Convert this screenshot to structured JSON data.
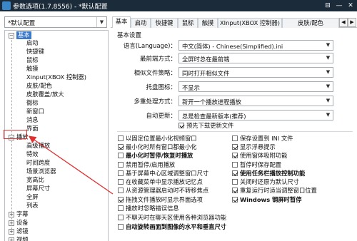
{
  "window": {
    "title": "参数选项(1.7.8556) - *默认配置",
    "buttons": {
      "close_prev": "⊟",
      "minimize": "—",
      "close": "✕"
    }
  },
  "profile": {
    "selected": "*默认配置"
  },
  "tree": {
    "groups": [
      {
        "label": "基本",
        "expanded": true,
        "selected": true,
        "children": [
          "启动",
          "快捷键",
          "鼠标",
          "触摸",
          "Xinput(XBOX 控制器)",
          "皮肤/配色",
          "皮肤覆盖/放大",
          "徽标",
          "新窗口",
          "消息",
          "界面"
        ]
      },
      {
        "label": "播放",
        "expanded": true,
        "highlighted": true,
        "children": [
          "高级播放",
          "特效",
          "时间跨度",
          "场景浏览器",
          "宽高比",
          "屏幕尺寸",
          "全屏",
          "列表"
        ]
      },
      {
        "label": "字幕",
        "expanded": false,
        "children": []
      },
      {
        "label": "设备",
        "expanded": false,
        "children": []
      },
      {
        "label": "滤镜",
        "expanded": false,
        "children": []
      },
      {
        "label": "视频",
        "expanded": false,
        "children": []
      }
    ]
  },
  "tabs": [
    "基本",
    "启动",
    "快捷键",
    "鼠标",
    "触摸",
    "XInput(XBOX 控制器)",
    "皮肤/配色"
  ],
  "active_tab": "基本",
  "settings": {
    "section_title": "基本设置",
    "rows": [
      {
        "label": "语言(Language)：",
        "value": "中文(简体) - Chinese(Simplified).ini"
      },
      {
        "label": "最前端方式：",
        "value": "全屏时总在最前端"
      },
      {
        "label": "相似文件策略：",
        "value": "同时打开相似文件"
      },
      {
        "label": "托盘图标：",
        "value": "不显示"
      },
      {
        "label": "多重处理方式：",
        "value": "新开一个播放进程播放"
      },
      {
        "label": "自动更新：",
        "value": "总是检查最新版本(推荐)"
      }
    ],
    "preload_update": {
      "label": "预先下载更新文件",
      "checked": true
    }
  },
  "checkboxes": {
    "left": [
      {
        "label": "以固定位置最小化视频窗口",
        "checked": false,
        "bold": false
      },
      {
        "label": "最小化时所有窗口都最小化",
        "checked": true,
        "bold": false
      },
      {
        "label": "最小化时暂停/恢复时播放",
        "checked": false,
        "bold": true
      },
      {
        "label": "禁用暂停/启用播放",
        "checked": false,
        "bold": false
      },
      {
        "label": "基于屏幕中心区域调整窗口尺寸",
        "checked": false,
        "bold": false
      },
      {
        "label": "在收藏菜单中显示播放记忆点",
        "checked": false,
        "bold": false
      },
      {
        "label": "从资源管理器启动时不转移焦点",
        "checked": false,
        "bold": false
      },
      {
        "label": "拖拽文件播放时显示界面选项",
        "checked": true,
        "bold": false
      },
      {
        "label": "播放时忽略错误信息",
        "checked": false,
        "bold": false
      },
      {
        "label": "不聊天时在聊天区使用各种浏览器功能",
        "checked": false,
        "bold": false
      },
      {
        "label": "自动旋转画面到图像的水平和垂直尺寸",
        "checked": false,
        "bold": true
      }
    ],
    "right": [
      {
        "label": "保存设置到 INI 文件",
        "checked": false,
        "bold": false
      },
      {
        "label": "显示浮悬提示",
        "checked": true,
        "bold": false
      },
      {
        "label": "使用窗体吸附功能",
        "checked": true,
        "bold": false
      },
      {
        "label": "暂停时保存配置",
        "checked": false,
        "bold": false
      },
      {
        "label": "使用任务栏播放控制功能",
        "checked": true,
        "bold": true
      },
      {
        "label": "关闭时还原为默认尺寸",
        "checked": false,
        "bold": false
      },
      {
        "label": "重复运行时适当调整窗口位置",
        "checked": true,
        "bold": false
      },
      {
        "label": "Windows 钢屏时暂停",
        "checked": true,
        "bold": true
      }
    ]
  },
  "colors": {
    "titlebar": "#1c2b39",
    "selection": "#3c78c8",
    "annotation": "#e03030"
  }
}
